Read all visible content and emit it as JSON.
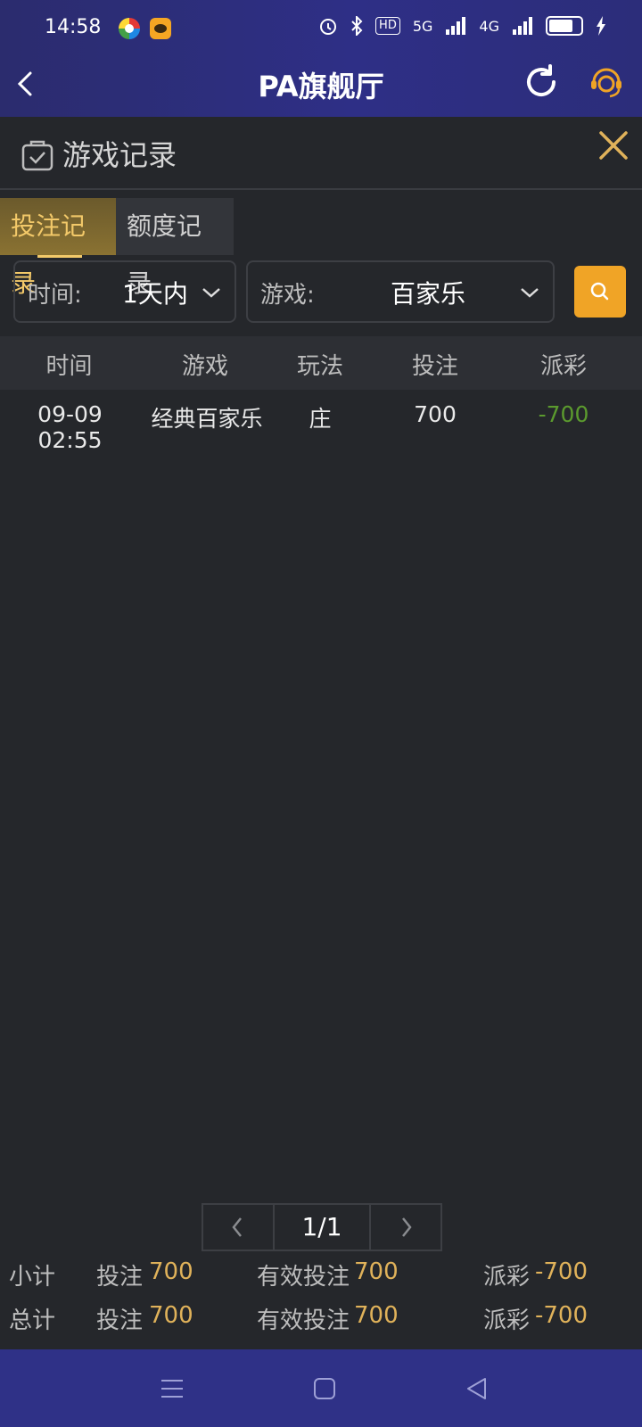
{
  "status": {
    "time": "14:58",
    "hd_badge": "HD",
    "net1": "5G",
    "net2": "4G"
  },
  "header": {
    "title": "PA旗舰厅"
  },
  "panel": {
    "title": "游戏记录"
  },
  "tabs": [
    {
      "label": "投注记录",
      "active": true
    },
    {
      "label": "额度记录",
      "active": false
    }
  ],
  "filters": {
    "time_label": "时间:",
    "time_value": "1天内",
    "game_label": "游戏:",
    "game_value": "百家乐"
  },
  "table": {
    "columns": [
      "时间",
      "游戏",
      "玩法",
      "投注",
      "派彩"
    ],
    "rows": [
      [
        "09-09 02:55",
        "经典百家乐",
        "庄",
        "700",
        "-700"
      ]
    ]
  },
  "pagination": {
    "page": "1/1"
  },
  "subtotal": {
    "label": "小计",
    "bet_label": "投注",
    "bet": "700",
    "valid_label": "有效投注",
    "valid": "700",
    "payout_label": "派彩",
    "payout": "-700"
  },
  "total": {
    "label": "总计",
    "bet_label": "投注",
    "bet": "700",
    "valid_label": "有效投注",
    "valid": "700",
    "payout_label": "派彩",
    "payout": "-700"
  },
  "colors": {
    "accent": "#f0a426",
    "gold_text": "#e0b25a",
    "negative": "#5b9a2e",
    "header_bg": "#2e2f86"
  }
}
